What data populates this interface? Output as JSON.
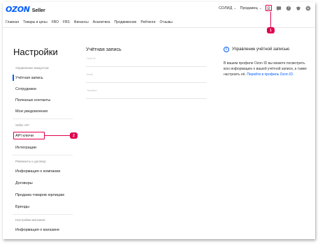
{
  "header": {
    "logo_brand": "OZON",
    "logo_product": "Seller",
    "company": "СОЛИД",
    "role": "Продавец",
    "icons": [
      "person-icon",
      "chat-icon",
      "help-icon",
      "education-icon",
      "gear-icon"
    ]
  },
  "nav": {
    "items": [
      "Главная",
      "Товары и цены",
      "FBO",
      "FBS",
      "Финансы",
      "Аналитика",
      "Продвижение",
      "Рейтинги",
      "Отзывы"
    ]
  },
  "callouts": [
    "1",
    "2"
  ],
  "sidebar": {
    "title": "Настройки",
    "groups": [
      {
        "label": "Управление аккаунтом",
        "items": [
          "Учётная запись",
          "Сотрудники",
          "Полезные контакты",
          "Мои уведомления"
        ]
      },
      {
        "label": "Seller API",
        "items": [
          "API ключи",
          "Интеграции"
        ]
      },
      {
        "label": "Реквизиты и договор",
        "items": [
          "Информация о компании",
          "Договоры",
          "Продажа товаров юрлицам",
          "Бренды"
        ]
      },
      {
        "label": "Настройки магазина",
        "items": [
          "Информация о магазине"
        ]
      }
    ],
    "active_item": "Учётная запись"
  },
  "main": {
    "title": "Учётная запись",
    "fields": [
      {
        "label": "Ozon ID"
      },
      {
        "label": "Email"
      },
      {
        "label": "Телефон"
      }
    ]
  },
  "info": {
    "title": "Управление учётной записью",
    "text": "В вашем профиле Ozon ID вы можете посмотреть всю информацию о вашей учётной записи, а также настроить её.",
    "link": "Перейти в профиль Ozon ID."
  },
  "colors": {
    "accent": "#005bff",
    "highlight": "#e0004d"
  }
}
